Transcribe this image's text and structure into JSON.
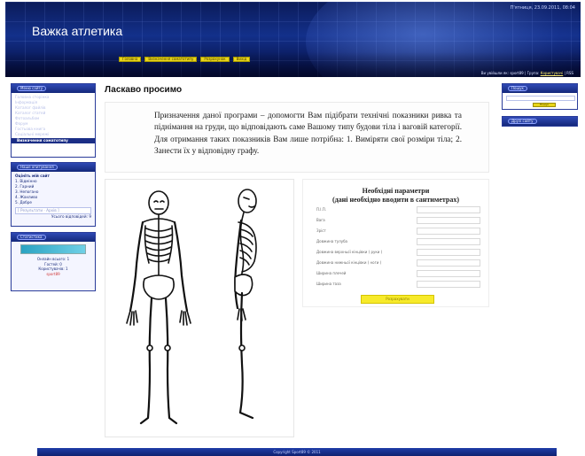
{
  "header": {
    "site_title": "Важка атлетика",
    "datetime": "П'ятниця, 23.09.2011, 08:04",
    "nav": [
      "Головна",
      "Визначення соматотипу",
      "Розрахунок",
      "Вихід"
    ],
    "userbar_prefix": "Ви увійшли як: sport89 | Група: ",
    "userbar_group": "Користувачі",
    "userbar_suffix": " | RSS"
  },
  "menu_block": {
    "title": "Меню сайту",
    "items": [
      "Головна сторінка",
      "Інформація",
      "Каталог файлів",
      "Каталог статей",
      "Фотоальбом",
      "Форум",
      "Гостьова книга",
      "Соціальні мережі"
    ],
    "active_item": "Визначення соматотипу"
  },
  "poll_block": {
    "title": "Наше опитування",
    "question": "Оцініть мій сайт",
    "options": [
      "1. Відмінно",
      "2. Гарний",
      "3. Непогано",
      "4. Жахливо",
      "5. Добре"
    ],
    "results_label": "[ Результати · Архів ]",
    "total_label": "Усього відповідей: 9"
  },
  "stats_block": {
    "title": "Статистика",
    "online_total": "Онлайн всього: 1",
    "guests": "Гостей: 0",
    "users": "Користувачів: 1",
    "username": "sport89"
  },
  "search_block": {
    "title": "Пошук",
    "button": "Пошук"
  },
  "friends_block": {
    "title": "Друзі сайту"
  },
  "main": {
    "title": "Ласкаво просимо",
    "intro": "Призначення даної програми – допомогти Вам підібрати технічні показники ривка та піднімання на груди, що відповідають саме Вашому типу будови тіла і ваговій категорії.    Для отримання таких показників Вам лише потрібна: 1. Виміряти свої розміри тіла; 2. Занести їх у відповідну графу."
  },
  "form": {
    "title_line1": "Необхідні параметри",
    "title_line2": "(дані необхідно вводити в сантиметрах)",
    "fields": [
      "П.І.П.",
      "Вага",
      "Зріст",
      "Довжина тулуба",
      "Довжина верхньої кінцівки ( руки )",
      "Довжина нижньої кінцівки ( ноги )",
      "Ширина плечей",
      "Ширина таза"
    ],
    "button": "Розрахувати"
  },
  "footer": {
    "copyright": "Copyright Sport89 © 2011"
  }
}
